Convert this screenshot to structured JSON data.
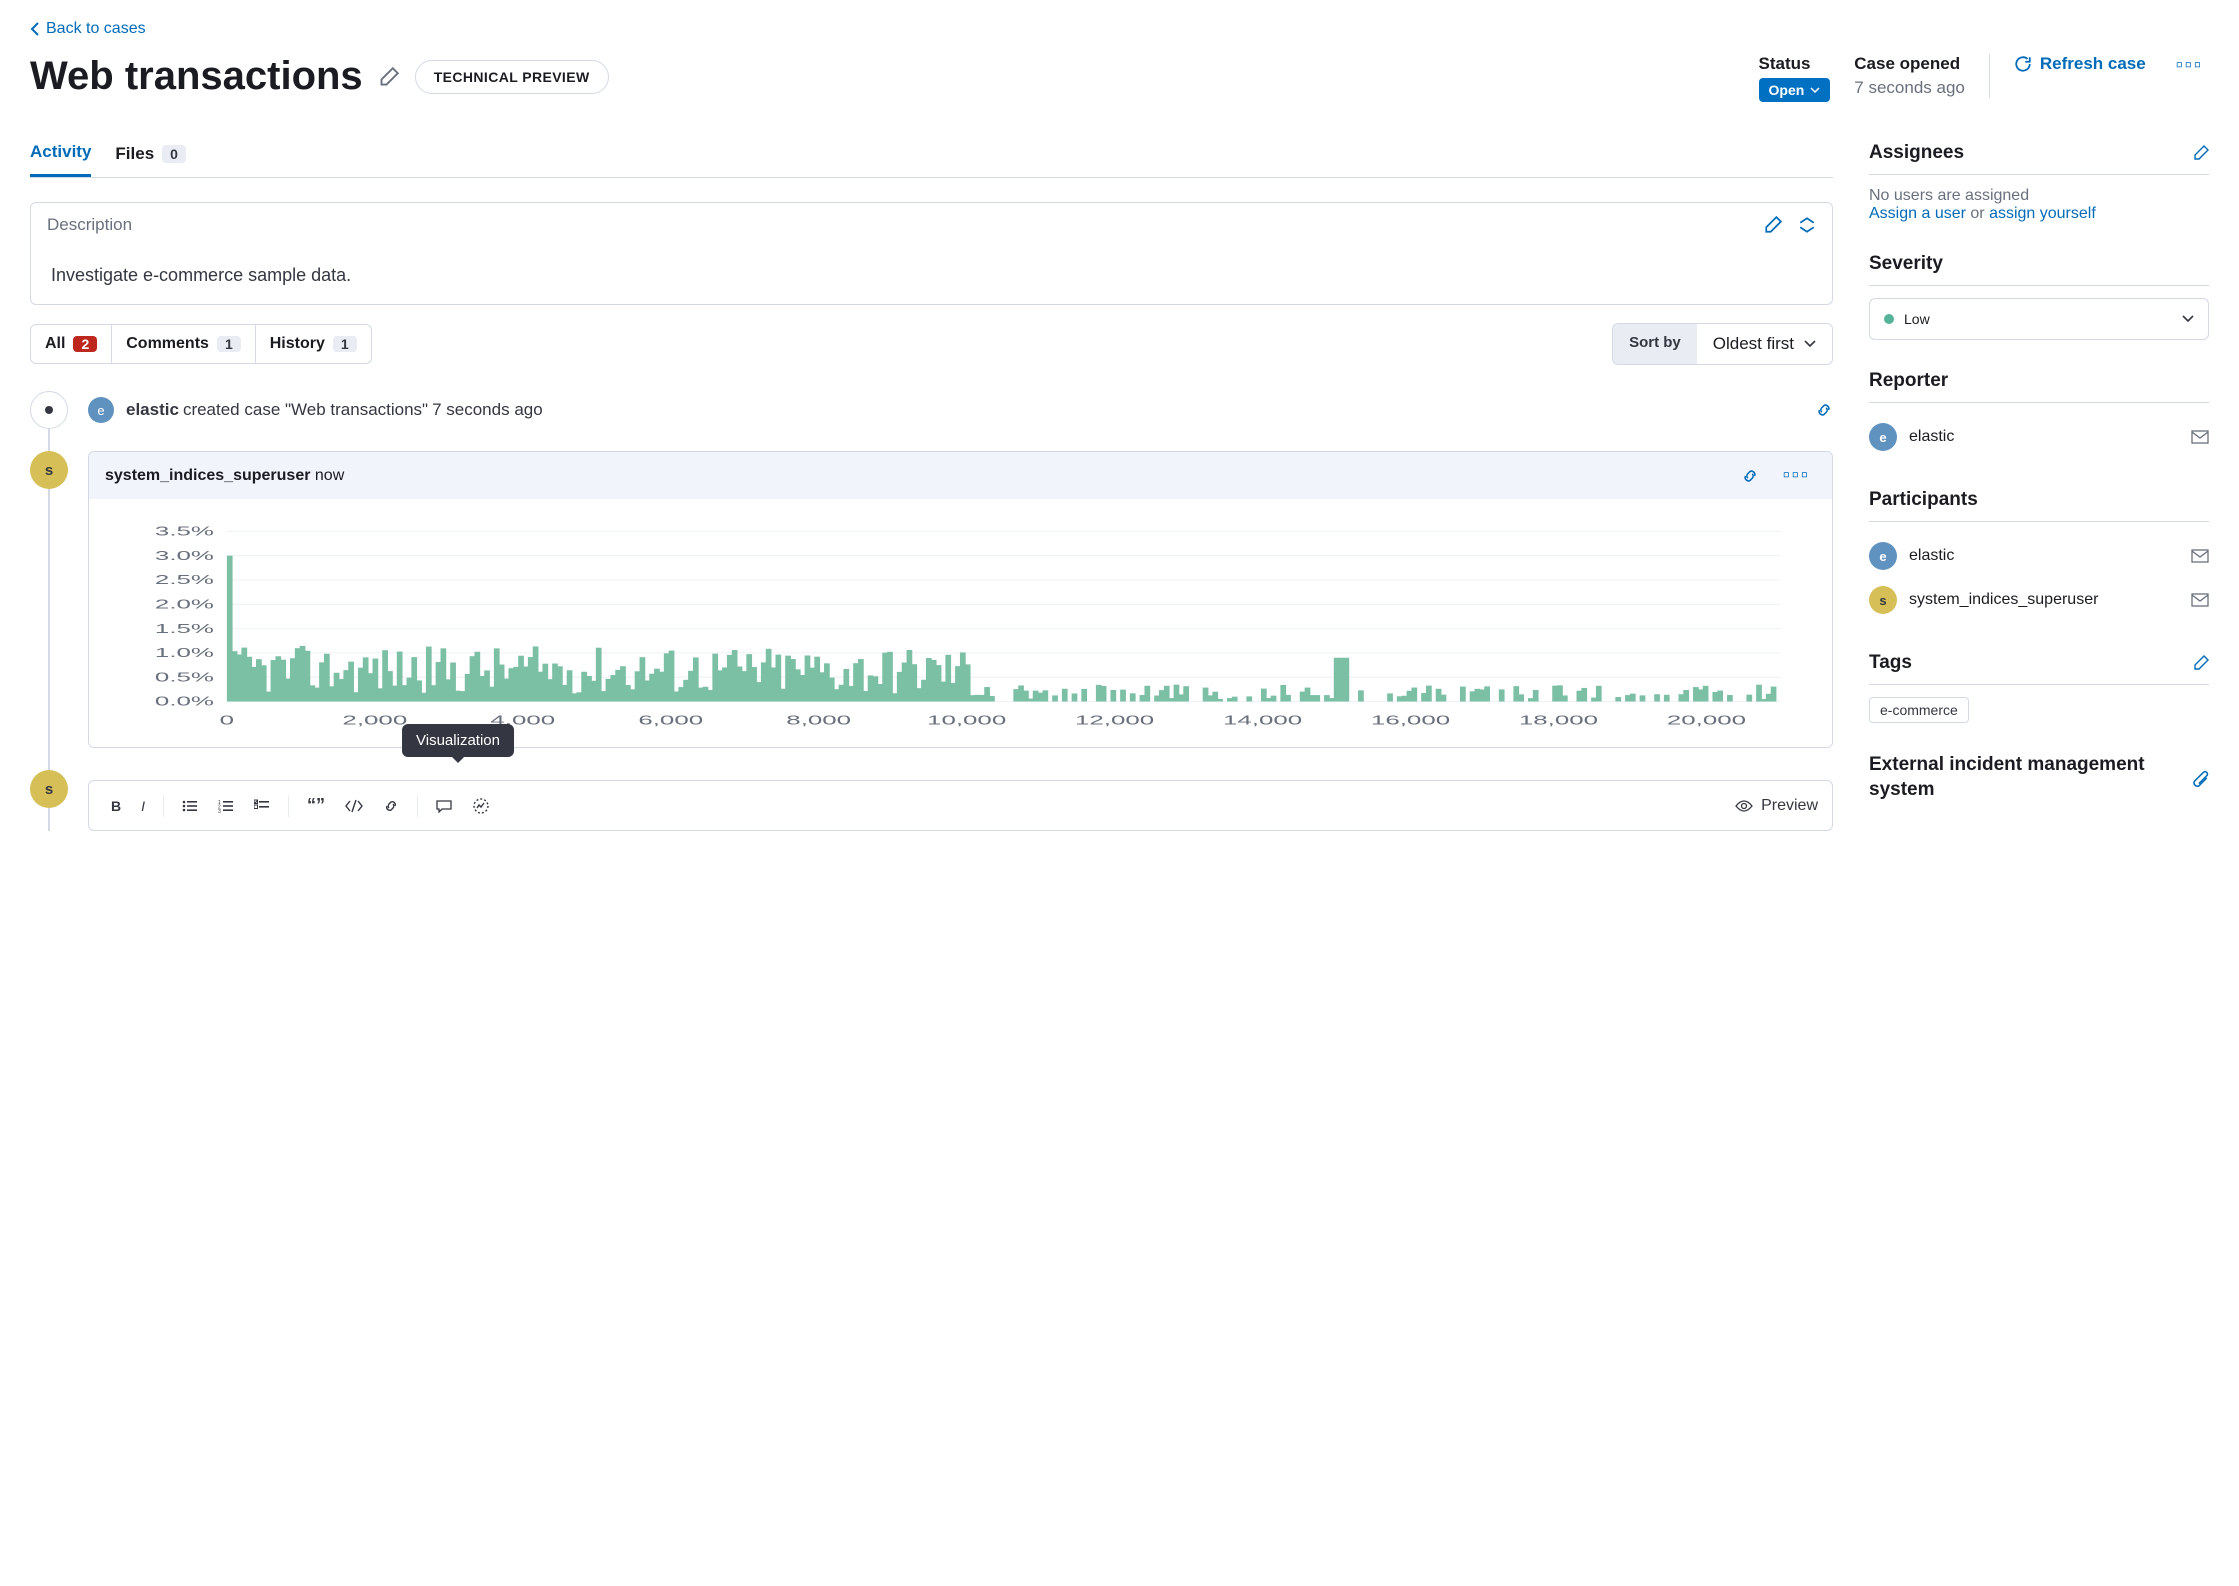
{
  "back_link": "Back to cases",
  "title": "Web transactions",
  "preview_badge": "TECHNICAL PREVIEW",
  "header": {
    "status_label": "Status",
    "status_value": "Open",
    "opened_label": "Case opened",
    "opened_value": "7 seconds ago",
    "refresh": "Refresh case"
  },
  "tabs": {
    "activity": "Activity",
    "files": "Files",
    "files_count": "0"
  },
  "desc": {
    "label": "Description",
    "body": "Investigate e-commerce sample data."
  },
  "filters": {
    "all": "All",
    "all_count": "2",
    "comments": "Comments",
    "comments_count": "1",
    "history": "History",
    "history_count": "1",
    "sort_label": "Sort by",
    "sort_value": "Oldest first"
  },
  "timeline": {
    "ev1_user": "elastic",
    "ev1_text": " created case \"Web transactions\" ",
    "ev1_time": "7 seconds ago",
    "ev2_user": "system_indices_superuser",
    "ev2_time": " now",
    "tooltip": "Visualization",
    "preview": "Preview"
  },
  "side": {
    "assignees": "Assignees",
    "assignees_empty": "No users are assigned",
    "assign_user": "Assign a user",
    "or": " or ",
    "assign_yourself": "assign yourself",
    "severity": "Severity",
    "severity_value": "Low",
    "reporter": "Reporter",
    "reporter_user": "elastic",
    "participants": "Participants",
    "part1": "elastic",
    "part2": "system_indices_superuser",
    "tags": "Tags",
    "tag1": "e-commerce",
    "external": "External incident management system"
  },
  "chart_data": {
    "type": "bar",
    "title": "",
    "xlabel": "",
    "ylabel": "",
    "xlim": [
      0,
      21000
    ],
    "ylim": [
      0,
      3.5
    ],
    "y_ticks": [
      "0.0%",
      "0.5%",
      "1.0%",
      "1.5%",
      "2.0%",
      "2.5%",
      "3.0%",
      "3.5%"
    ],
    "x_ticks": [
      "0",
      "2,000",
      "4,000",
      "6,000",
      "8,000",
      "10,000",
      "12,000",
      "14,000",
      "16,000",
      "18,000",
      "20,000"
    ],
    "summary": "Histogram-like bars. A single spike near x≈0 at ~3%. Dense bars mostly in 0.2%–1.2% range from x≈200 to x≈10,000. Sparse low bars (~0.1%–0.4%) from ~10,000 to ~20,000 with one small spike near 15,000."
  }
}
